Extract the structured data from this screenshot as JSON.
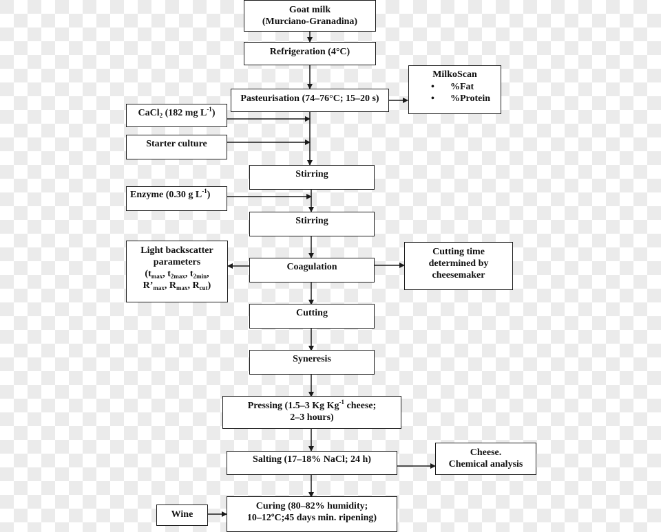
{
  "diagram": {
    "type": "flowchart",
    "main_steps": [
      {
        "id": "goat-milk",
        "lines": [
          "Goat milk",
          "(Murciano-Granadina)"
        ]
      },
      {
        "id": "refrigeration",
        "lines": [
          "Refrigeration (4°C)"
        ]
      },
      {
        "id": "pasteurisation",
        "lines": [
          "Pasteurisation (74–76°C; 15–20 s)"
        ]
      },
      {
        "id": "stirring-1",
        "lines": [
          "Stirring"
        ]
      },
      {
        "id": "stirring-2",
        "lines": [
          "Stirring"
        ]
      },
      {
        "id": "coagulation",
        "lines": [
          "Coagulation"
        ]
      },
      {
        "id": "cutting",
        "lines": [
          "Cutting"
        ]
      },
      {
        "id": "syneresis",
        "lines": [
          "Syneresis"
        ]
      },
      {
        "id": "pressing",
        "lines": [
          "Pressing (1.5–3 Kg Kg-1 cheese;",
          "2–3 hours)"
        ]
      },
      {
        "id": "salting",
        "lines": [
          "Salting (17–18% NaCl; 24 h)"
        ]
      },
      {
        "id": "curing",
        "lines": [
          "Curing (80–82% humidity;",
          "10–12ºC;45 days min. ripening)"
        ]
      }
    ],
    "inputs": {
      "cacl2": {
        "prefix": "CaCl",
        "sub": "2",
        "middle": " (182 mg L",
        "sup": "-1",
        "suffix": ")"
      },
      "starter": "Starter culture",
      "enzyme": {
        "prefix": "Enzyme (0.30 g L",
        "sup": "-1",
        "suffix": ")"
      },
      "wine": "Wine"
    },
    "outputs": {
      "milkoscan": {
        "title": "MilkoScan",
        "items": [
          "%Fat",
          "%Protein"
        ]
      },
      "light_backscatter": {
        "line1": "Light backscatter",
        "line2": "parameters",
        "params_line1": [
          {
            "base": "(t",
            "sub": "max"
          },
          {
            "base": ", t",
            "sub": "2max"
          },
          {
            "base": ", t",
            "sub": "2min"
          },
          {
            "base": ",",
            "sub": ""
          }
        ],
        "params_line2": [
          {
            "base": "R’",
            "sub": "max"
          },
          {
            "base": ", R",
            "sub": "max"
          },
          {
            "base": ", R",
            "sub": "cut"
          },
          {
            "base": ")",
            "sub": ""
          }
        ]
      },
      "cutting_time": [
        "Cutting time",
        "determined by",
        "cheesemaker"
      ],
      "cheese_analysis": [
        "Cheese.",
        "Chemical analysis"
      ]
    },
    "pressing_parts": {
      "a": "Pressing (1.5–3 Kg Kg",
      "sup": "-1",
      "b": " cheese;",
      "line2": "2–3 hours)"
    },
    "colors": {
      "line": "#1a1a1a",
      "box_fill": "#ffffff",
      "checker": "#ebebeb"
    }
  }
}
